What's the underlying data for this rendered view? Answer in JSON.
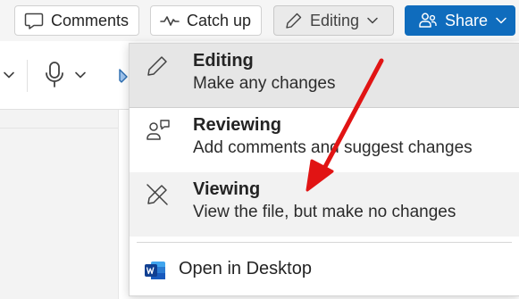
{
  "toolbar": {
    "comments_label": "Comments",
    "catchup_label": "Catch up",
    "editing_label": "Editing",
    "share_label": "Share"
  },
  "menu": {
    "items": [
      {
        "title": "Editing",
        "description": "Make any changes",
        "icon": "pencil-icon"
      },
      {
        "title": "Reviewing",
        "description": "Add comments and suggest changes",
        "icon": "reviewing-icon"
      },
      {
        "title": "Viewing",
        "description": "View the file, but make no changes",
        "icon": "pencil-off-icon"
      }
    ],
    "open_desktop_label": "Open in Desktop"
  },
  "colors": {
    "share_bg": "#0f6cbd",
    "selected_bg": "#e6e6e6",
    "annotation_arrow": "#e11414"
  }
}
